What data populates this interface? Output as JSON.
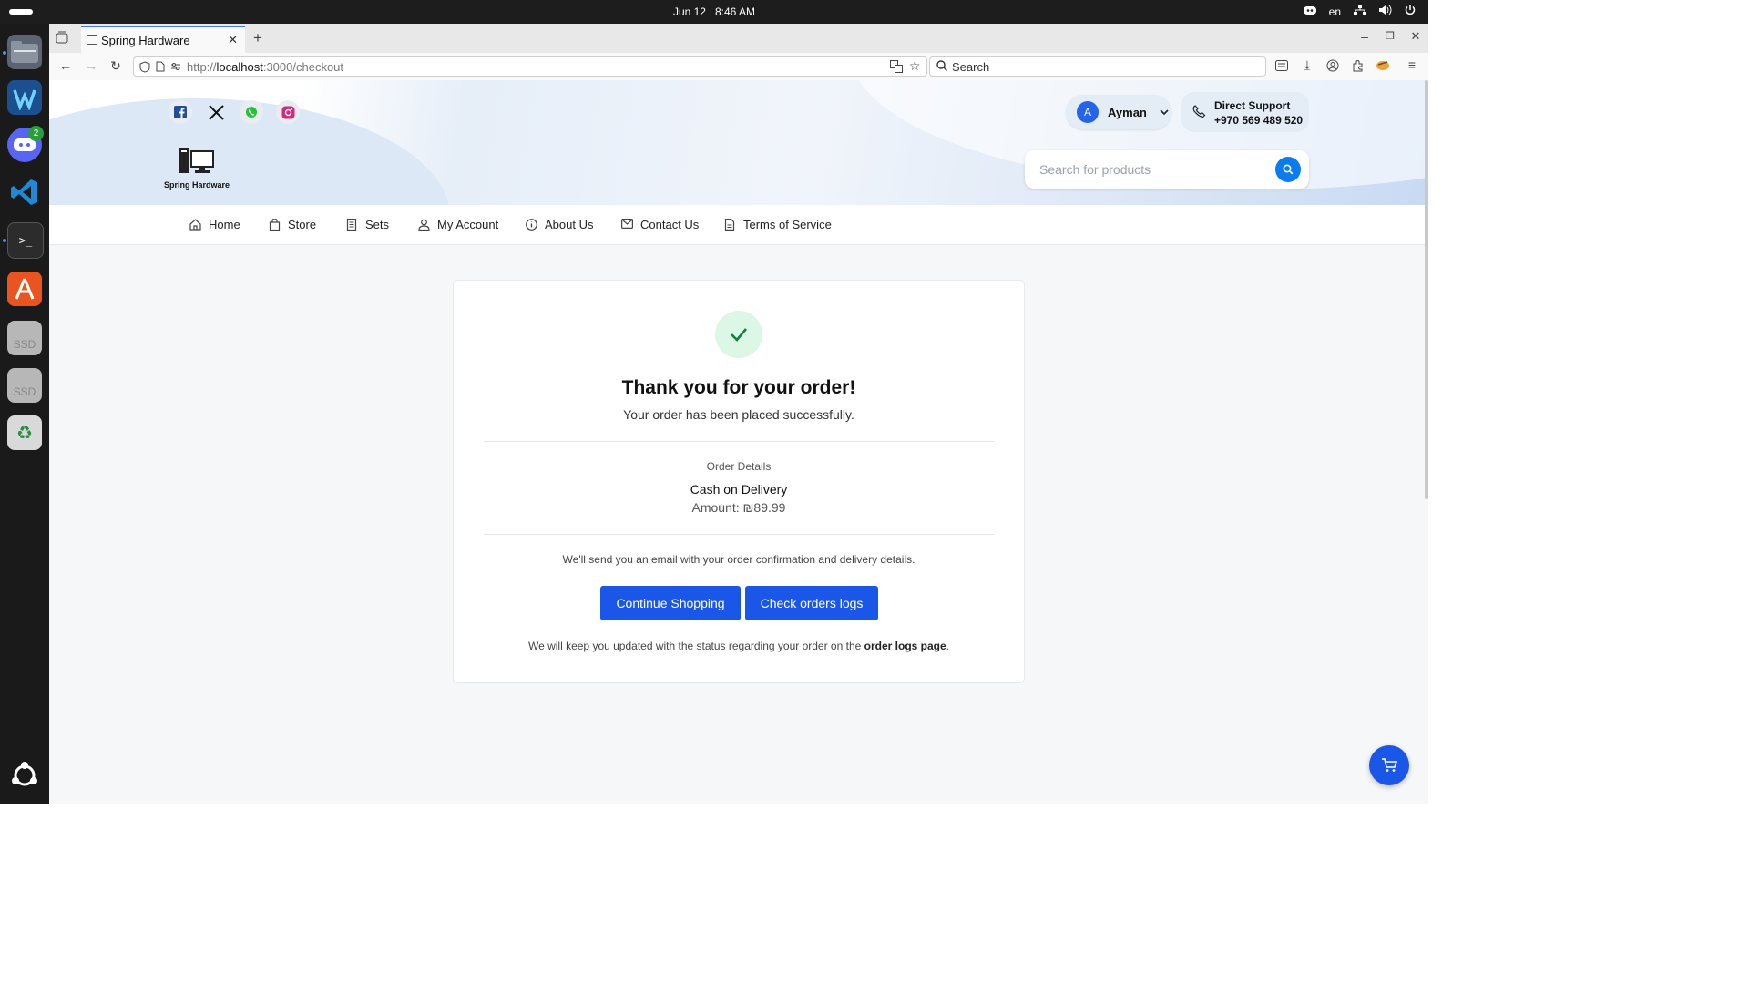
{
  "system": {
    "date": "Jun 12",
    "time": "8:46 AM",
    "lang": "en"
  },
  "dock": {
    "discord_badge": "2",
    "ssd1": "SSD",
    "ssd2": "SSD"
  },
  "browser": {
    "tab_title": "Spring Hardware",
    "url_prefix": "http://",
    "url_host": "localhost",
    "url_path": ":3000/checkout",
    "search_placeholder": "Search"
  },
  "header": {
    "brand": "Spring Hardware",
    "user_initial": "A",
    "user_name": "Ayman",
    "support_label": "Direct Support",
    "support_phone": "+970 569 489 520",
    "search_placeholder": "Search for products"
  },
  "nav": {
    "items": [
      {
        "label": "Home",
        "icon": "home-icon"
      },
      {
        "label": "Store",
        "icon": "bag-icon"
      },
      {
        "label": "Sets",
        "icon": "receipt-icon"
      },
      {
        "label": "My Account",
        "icon": "user-icon"
      },
      {
        "label": "About Us",
        "icon": "info-icon"
      },
      {
        "label": "Contact Us",
        "icon": "mail-icon"
      },
      {
        "label": "Terms of Service",
        "icon": "document-icon"
      }
    ]
  },
  "confirmation": {
    "title": "Thank you for your order!",
    "subtitle": "Your order has been placed successfully.",
    "details_label": "Order Details",
    "payment_method": "Cash on Delivery",
    "amount": "Amount: ₪89.99",
    "email_note": "We'll send you an email with your order confirmation and delivery details.",
    "continue_label": "Continue Shopping",
    "logs_label": "Check orders logs",
    "footer_text": "We will keep you updated with the status regarding your order on the",
    "footer_link": "order logs page",
    "footer_end": "."
  },
  "colors": {
    "primary": "#1a56e8",
    "success_bg": "#dcf7e6",
    "success_fg": "#13803d"
  }
}
